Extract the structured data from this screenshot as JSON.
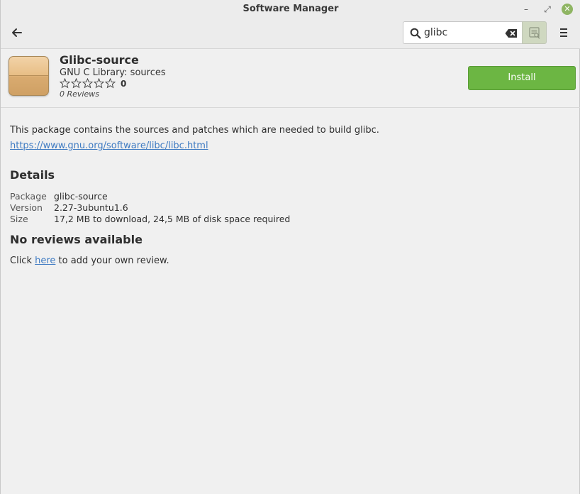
{
  "window": {
    "title": "Software Manager",
    "minimize_glyph": "–",
    "maximize_glyph": "⤢",
    "close_glyph": "✕"
  },
  "toolbar": {
    "back_icon": "arrow-left-icon",
    "search": {
      "value": "glibc",
      "icon": "magnifier-icon",
      "clear_icon": "backspace-clear-icon"
    },
    "search_button_icon": "search-in-description-icon",
    "menu_icon": "hamburger-menu-icon"
  },
  "package": {
    "name": "Glibc-source",
    "summary": "GNU C Library: sources",
    "rating": 0,
    "rating_max": 5,
    "rating_label": "0",
    "reviews_label": "0 Reviews",
    "install_label": "Install",
    "description": "This package contains the sources and patches which are needed to build glibc.",
    "homepage": "https://www.gnu.org/software/libc/libc.html"
  },
  "details": {
    "title": "Details",
    "rows": [
      {
        "label": "Package",
        "value": "glibc-source"
      },
      {
        "label": "Version",
        "value": "2.27-3ubuntu1.6"
      },
      {
        "label": "Size",
        "value": "17,2 MB to download, 24,5 MB of disk space required"
      }
    ]
  },
  "reviews": {
    "title": "No reviews available",
    "prefix": "Click ",
    "link": "here",
    "suffix": " to add your own review."
  },
  "colors": {
    "install_button": "#6cb643",
    "link": "#3f7bc2",
    "close_button": "#8fb563"
  }
}
